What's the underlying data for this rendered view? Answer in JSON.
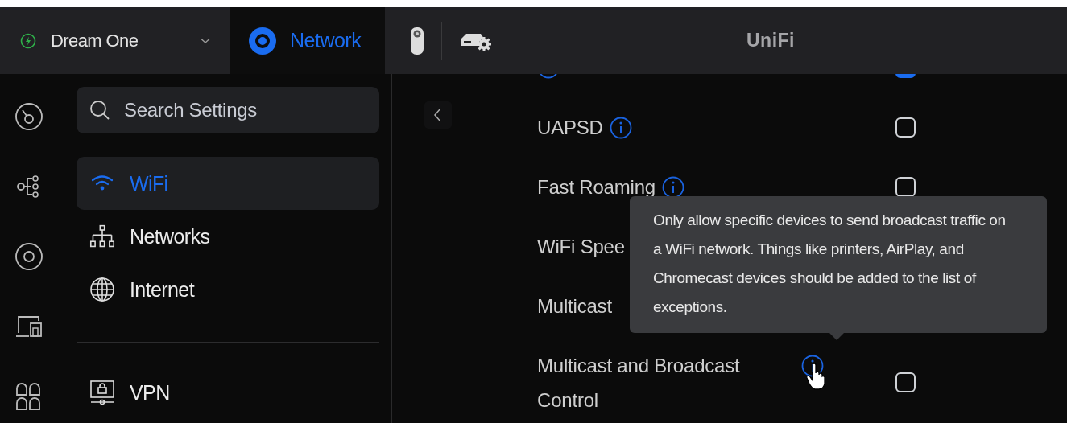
{
  "top_bar": {
    "device_selector": {
      "name": "Dream One"
    },
    "app_tabs": [
      {
        "kind": "network",
        "label": "Network",
        "selected": true
      },
      {
        "kind": "camera",
        "selected": false
      },
      {
        "kind": "device-settings",
        "selected": false
      }
    ],
    "brand": "UniFi"
  },
  "search": {
    "placeholder": "Search Settings"
  },
  "nav_groups": [
    [
      {
        "kind": "wifi",
        "label": "WiFi",
        "selected": true
      },
      {
        "kind": "networks",
        "label": "Networks",
        "selected": false
      },
      {
        "kind": "internet",
        "label": "Internet",
        "selected": false
      }
    ],
    [
      {
        "kind": "vpn",
        "label": "VPN",
        "selected": false
      }
    ]
  ],
  "settings": {
    "clipped_row": {
      "checked": true
    },
    "rows": [
      {
        "label": "UAPSD",
        "checked": false
      },
      {
        "label": "Fast Roaming",
        "checked": false
      },
      {
        "label": "WiFi Spee"
      },
      {
        "label": "Multicast"
      },
      {
        "label": "Multicast and Broadcast Control",
        "checked": false,
        "hovered": true
      }
    ]
  },
  "tooltip": {
    "text": "Only allow specific devices to send broadcast traffic on a WiFi network. Things like printers, AirPlay, and Chromecast devices should be added to the list of exceptions."
  }
}
